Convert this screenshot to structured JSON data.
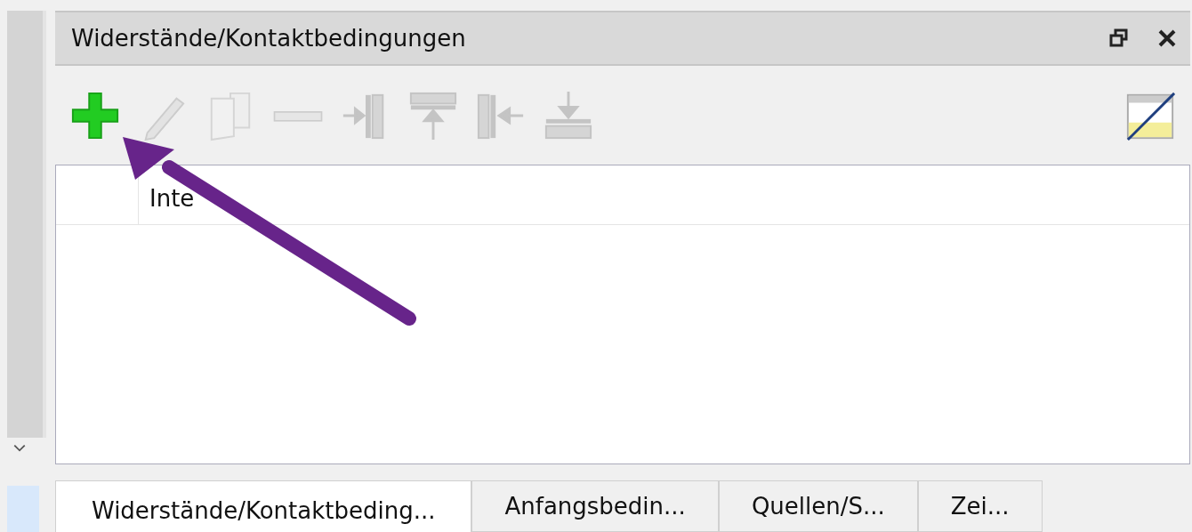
{
  "panel": {
    "title": "Widerstände/Kontaktbedingungen"
  },
  "toolbar": [
    {
      "kind": "add",
      "disabled": false
    },
    {
      "kind": "edit",
      "disabled": true
    },
    {
      "kind": "copy",
      "disabled": true
    },
    {
      "kind": "remove",
      "disabled": true
    },
    {
      "kind": "wall-right",
      "disabled": true
    },
    {
      "kind": "wall-top",
      "disabled": true
    },
    {
      "kind": "wall-left",
      "disabled": true
    },
    {
      "kind": "wall-bottom",
      "disabled": true
    }
  ],
  "table": {
    "columns": [
      "Inte"
    ]
  },
  "tabs": [
    {
      "label": "Widerstände/Kontaktbeding...",
      "selected": true
    },
    {
      "label": "Anfangsbedin...",
      "selected": false
    },
    {
      "label": "Quellen/S...",
      "selected": false
    },
    {
      "label": "Zei...",
      "selected": false
    }
  ]
}
